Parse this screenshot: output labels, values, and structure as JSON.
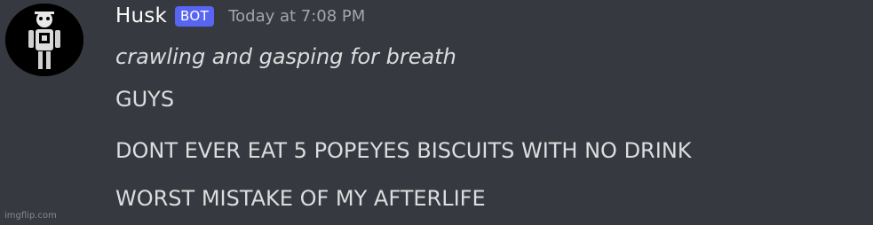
{
  "message": {
    "author": {
      "name": "Husk",
      "tag": "BOT",
      "avatar_icon": "skeleton-figure-avatar"
    },
    "timestamp": "Today at 7:08 PM",
    "lines": [
      "crawling and gasping for breath",
      "GUYS",
      "DONT EVER EAT 5 POPEYES BISCUITS WITH NO DRINK",
      "WORST MISTAKE OF MY AFTERLIFE"
    ]
  },
  "watermark": "imgflip.com",
  "colors": {
    "background": "#36393f",
    "username": "#ffffff",
    "bot_tag": "#5865f2",
    "timestamp": "#a3a6aa",
    "text": "#dcddde"
  }
}
